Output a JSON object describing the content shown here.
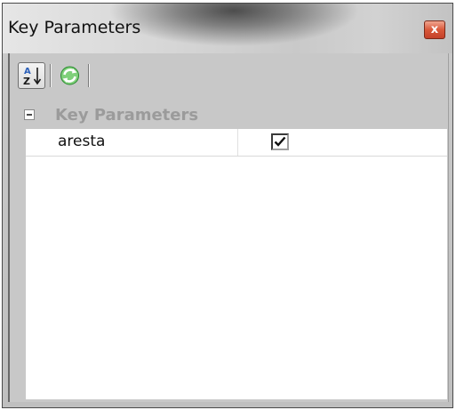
{
  "window": {
    "title": "Key Parameters",
    "close_glyph": "x"
  },
  "toolbar": {
    "buttons": [
      {
        "icon": "sort-alphabetical-icon",
        "glyph_top": "A",
        "glyph_bottom": "Z",
        "pressed": true
      },
      {
        "icon": "refresh-icon",
        "pressed": false
      }
    ]
  },
  "property_grid": {
    "group": {
      "label": "Key Parameters",
      "expanded": true
    },
    "rows": [
      {
        "name": "aresta",
        "checked": true
      }
    ]
  },
  "colors": {
    "refresh_green": "#2fa63a",
    "sort_blue": "#2b5fb8",
    "close_red": "#d9583a"
  }
}
